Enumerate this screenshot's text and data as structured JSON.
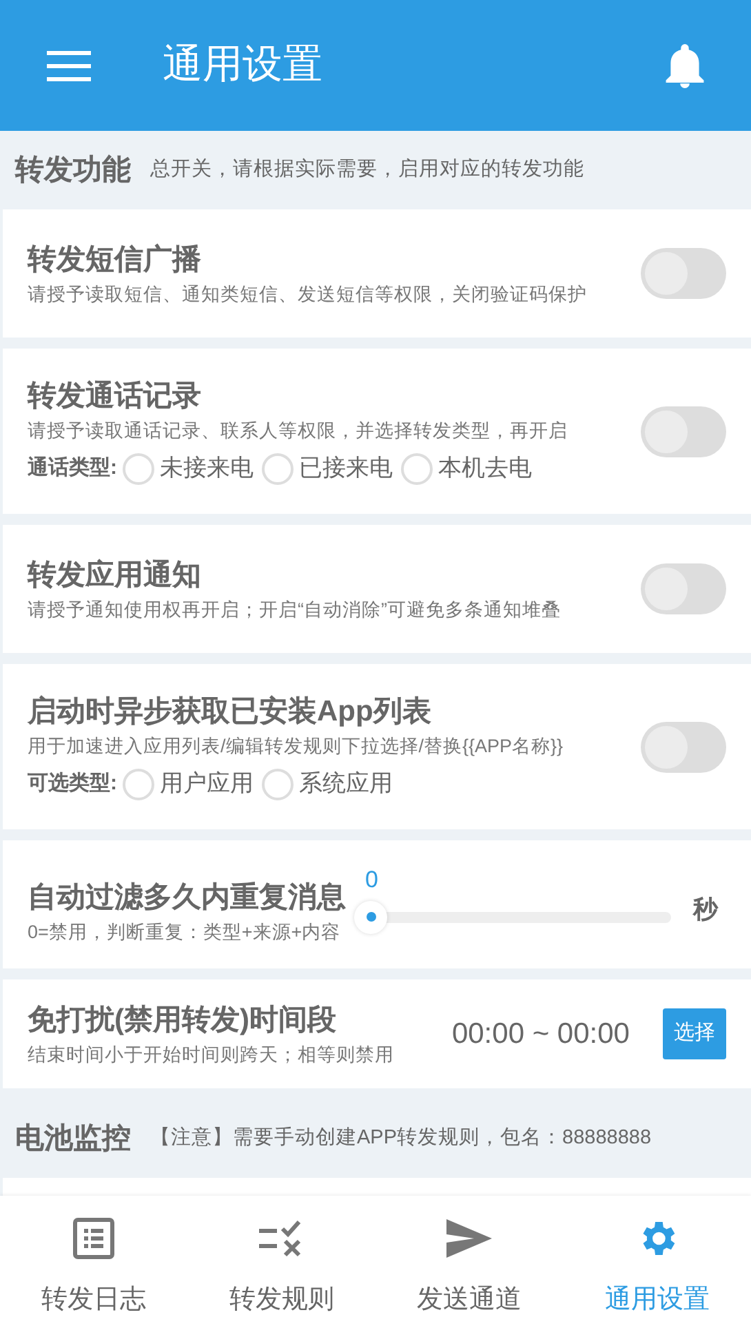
{
  "app_bar": {
    "title": "通用设置"
  },
  "sections": [
    {
      "title": "转发功能",
      "note": "总开关，请根据实际需要，启用对应的转发功能",
      "items": [
        {
          "kind": "switch",
          "title": "转发短信广播",
          "description": "请授予读取短信、通知类短信、发送短信等权限，关闭验证码保护",
          "on": false
        },
        {
          "kind": "switch",
          "title": "转发通话记录",
          "description": "请授予读取通话记录、联系人等权限，并选择转发类型，再开启",
          "on": false,
          "options_label": "通话类型:",
          "options": [
            {
              "label": "未接来电",
              "checked": false
            },
            {
              "label": "已接来电",
              "checked": false
            },
            {
              "label": "本机去电",
              "checked": false
            }
          ]
        },
        {
          "kind": "switch",
          "title": "转发应用通知",
          "description": "请授予通知使用权再开启；开启“自动消除”可避免多条通知堆叠",
          "on": false
        },
        {
          "kind": "switch",
          "title": "启动时异步获取已安装App列表",
          "description": "用于加速进入应用列表/编辑转发规则下拉选择/替换{{APP名称}}",
          "on": false,
          "options_label": "可选类型:",
          "options": [
            {
              "label": "用户应用",
              "checked": false
            },
            {
              "label": "系统应用",
              "checked": false
            }
          ]
        },
        {
          "kind": "slider",
          "title": "自动过滤多久内重复消息",
          "description": "0=禁用，判断重复：类型+来源+内容",
          "value": "0",
          "unit": "秒"
        },
        {
          "kind": "time",
          "title": "免打扰(禁用转发)时间段",
          "description": "结束时间小于开始时间则跨天；相等则禁用",
          "range": "00:00 ~ 00:00",
          "button": "选择"
        }
      ]
    },
    {
      "title": "电池监控",
      "note": "【注意】需要手动创建APP转发规则，包名：88888888"
    }
  ],
  "bottom_nav": [
    {
      "label": "转发日志",
      "selected": false
    },
    {
      "label": "转发规则",
      "selected": false
    },
    {
      "label": "发送通道",
      "selected": false
    },
    {
      "label": "通用设置",
      "selected": true
    }
  ]
}
